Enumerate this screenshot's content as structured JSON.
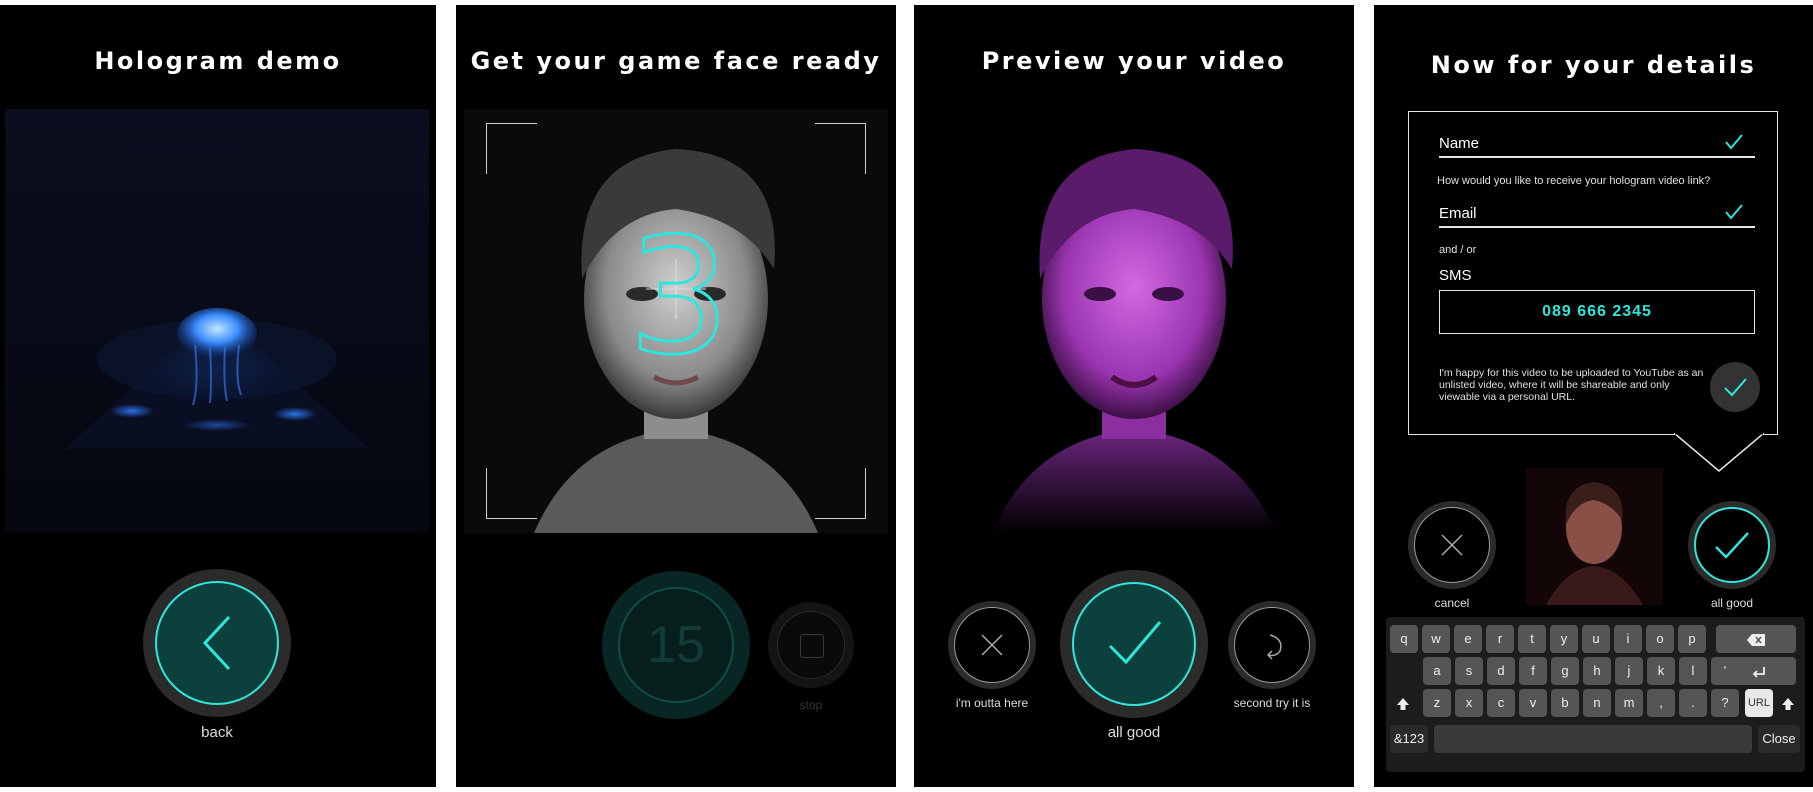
{
  "panels": {
    "demo": {
      "title": "Hologram demo",
      "back_label": "back"
    },
    "countdown": {
      "title": "Get your game face ready",
      "count": "3",
      "timer": "15",
      "stop_label": "stop"
    },
    "preview": {
      "title": "Preview your video",
      "cancel_label": "i'm outta here",
      "ok_label": "all good",
      "retry_label": "second try it is"
    },
    "details": {
      "title": "Now for your details",
      "name_label": "Name",
      "question": "How would you like to receive your hologram video link?",
      "email_label": "Email",
      "and_or": "and / or",
      "sms_label": "SMS",
      "sms_value": "089 666 2345",
      "consent": "I'm happy for this video to be uploaded to YouTube as an unlisted video, where it will be shareable and only viewable via a personal URL.",
      "cancel_label": "cancel",
      "ok_label": "all good"
    }
  },
  "keyboard": {
    "row1": [
      "q",
      "w",
      "e",
      "r",
      "t",
      "y",
      "u",
      "i",
      "o",
      "p"
    ],
    "row2": [
      "a",
      "s",
      "d",
      "f",
      "g",
      "h",
      "j",
      "k",
      "l",
      "'"
    ],
    "row3": [
      "z",
      "x",
      "c",
      "v",
      "b",
      "n",
      "m",
      ",",
      ".",
      "?"
    ],
    "url_key": "URL",
    "numbers_key": "&123",
    "close_key": "Close",
    "backspace_icon": "backspace-icon",
    "return_icon": "return-icon",
    "shift_icon": "shift-icon"
  },
  "colors": {
    "accent": "#2ee6dc",
    "teal_dark": "#0f3d3a",
    "magenta": "#b43cc8"
  }
}
